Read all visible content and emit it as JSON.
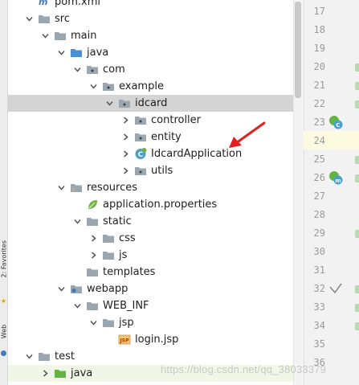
{
  "sidebar_strip": {
    "favorites_label": "2: Favorites",
    "web_label": "Web"
  },
  "tree": [
    {
      "label": "pom.xml",
      "icon": "maven-file-icon",
      "depth": 0,
      "chevron": "none"
    },
    {
      "label": "src",
      "icon": "folder-icon",
      "depth": 0,
      "chevron": "expanded"
    },
    {
      "label": "main",
      "icon": "folder-icon",
      "depth": 1,
      "chevron": "expanded"
    },
    {
      "label": "java",
      "icon": "source-folder-icon",
      "depth": 2,
      "chevron": "expanded"
    },
    {
      "label": "com",
      "icon": "package-icon",
      "depth": 3,
      "chevron": "expanded"
    },
    {
      "label": "example",
      "icon": "package-icon",
      "depth": 4,
      "chevron": "expanded"
    },
    {
      "label": "idcard",
      "icon": "package-icon",
      "depth": 5,
      "chevron": "expanded",
      "selected": true
    },
    {
      "label": "controller",
      "icon": "package-icon",
      "depth": 6,
      "chevron": "collapsed"
    },
    {
      "label": "entity",
      "icon": "package-icon",
      "depth": 6,
      "chevron": "collapsed"
    },
    {
      "label": "IdcardApplication",
      "icon": "spring-boot-class-icon",
      "depth": 6,
      "chevron": "collapsed"
    },
    {
      "label": "utils",
      "icon": "package-icon",
      "depth": 6,
      "chevron": "collapsed"
    },
    {
      "label": "resources",
      "icon": "resources-folder-icon",
      "depth": 2,
      "chevron": "expanded"
    },
    {
      "label": "application.properties",
      "icon": "spring-properties-icon",
      "depth": 3,
      "chevron": "none"
    },
    {
      "label": "static",
      "icon": "folder-icon",
      "depth": 3,
      "chevron": "expanded"
    },
    {
      "label": "css",
      "icon": "folder-icon",
      "depth": 4,
      "chevron": "collapsed"
    },
    {
      "label": "js",
      "icon": "folder-icon",
      "depth": 4,
      "chevron": "collapsed"
    },
    {
      "label": "templates",
      "icon": "folder-icon",
      "depth": 3,
      "chevron": "none"
    },
    {
      "label": "webapp",
      "icon": "web-folder-icon",
      "depth": 2,
      "chevron": "expanded"
    },
    {
      "label": "WEB_INF",
      "icon": "folder-icon",
      "depth": 3,
      "chevron": "expanded"
    },
    {
      "label": "jsp",
      "icon": "folder-icon",
      "depth": 4,
      "chevron": "expanded"
    },
    {
      "label": "login.jsp",
      "icon": "jsp-file-icon",
      "depth": 5,
      "chevron": "none"
    },
    {
      "label": "test",
      "icon": "folder-icon",
      "depth": 0,
      "chevron": "expanded"
    },
    {
      "label": "java",
      "icon": "test-source-folder-icon",
      "depth": 1,
      "chevron": "collapsed",
      "bottom_highlight": true
    }
  ],
  "gutter": {
    "line_numbers": [
      "17",
      "18",
      "19",
      "20",
      "21",
      "22",
      "23",
      "24",
      "25",
      "26",
      "27",
      "28",
      "29",
      "30",
      "31",
      "32",
      "33",
      "34",
      "35",
      "36"
    ],
    "current_line": "24",
    "icons": [
      {
        "line": "23",
        "icon": "spring-bean-class-gutter-icon"
      },
      {
        "line": "26",
        "icon": "spring-bean-method-gutter-icon"
      },
      {
        "line": "32",
        "icon": "checkmark-icon"
      }
    ],
    "fold_marks": [
      "20",
      "21",
      "22",
      "25",
      "26",
      "29",
      "32",
      "33",
      "34"
    ]
  },
  "annotation": {
    "icon": "red-arrow-icon",
    "color": "#e02020"
  },
  "watermark": "https://blog.csdn.net/qq_38033379",
  "colors": {
    "folder": "#9aa7b0",
    "source_folder": "#4a90d9",
    "test_folder": "#62b543",
    "package_dot": "#3d3d3d",
    "selection": "#d4d4d4",
    "current_line": "#fcfbdf",
    "spring": "#6db33f"
  }
}
